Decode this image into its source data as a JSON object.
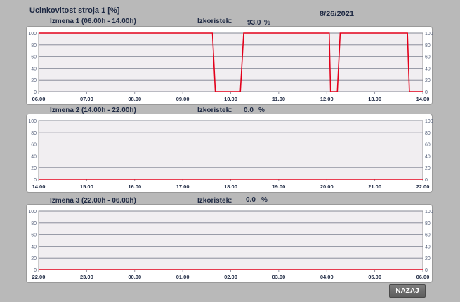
{
  "header": {
    "title": "Ucinkovitost stroja 1 [%]",
    "date": "8/26/2021"
  },
  "efficiency_label": "Izkoristek:",
  "unit": "%",
  "back_button": "NAZAJ",
  "colors": {
    "background": "#b9b9b9",
    "plot_area": "#f1eef1",
    "line": "#e3001b",
    "grid": "#7c8090"
  },
  "chart_data": [
    {
      "type": "line",
      "title": "Izmena 1 (06.00h - 14.00h)",
      "efficiency": "93.0",
      "ylim": [
        0,
        100
      ],
      "yticks": [
        "100",
        "80",
        "60",
        "40",
        "20",
        "0"
      ],
      "xticks": [
        "06.00",
        "07.00",
        "08.00",
        "09.00",
        "10.00",
        "11.00",
        "12.00",
        "13.00",
        "14.00"
      ],
      "x": [
        0,
        3.62,
        3.68,
        4.2,
        4.27,
        6.05,
        6.08,
        6.22,
        6.28,
        7.68,
        7.72,
        8.0
      ],
      "y": [
        100,
        100,
        0,
        0,
        100,
        100,
        0,
        0,
        100,
        100,
        0,
        0
      ]
    },
    {
      "type": "line",
      "title": "Izmena 2 (14.00h - 22.00h)",
      "efficiency": "0.0",
      "ylim": [
        0,
        100
      ],
      "yticks": [
        "100",
        "80",
        "60",
        "40",
        "20",
        "0"
      ],
      "xticks": [
        "14.00",
        "15.00",
        "16.00",
        "17.00",
        "18.00",
        "19.00",
        "20.00",
        "21.00",
        "22.00"
      ],
      "x": [
        0,
        8
      ],
      "y": [
        0,
        0
      ]
    },
    {
      "type": "line",
      "title": "Izmena 3 (22.00h - 06.00h)",
      "efficiency": "0.0",
      "ylim": [
        0,
        100
      ],
      "yticks": [
        "100",
        "80",
        "60",
        "40",
        "20",
        "0"
      ],
      "xticks": [
        "22.00",
        "23.00",
        "00.00",
        "01.00",
        "02.00",
        "03.00",
        "04.00",
        "05.00",
        "06.00"
      ],
      "x": [
        0,
        8
      ],
      "y": [
        0,
        0
      ]
    }
  ]
}
